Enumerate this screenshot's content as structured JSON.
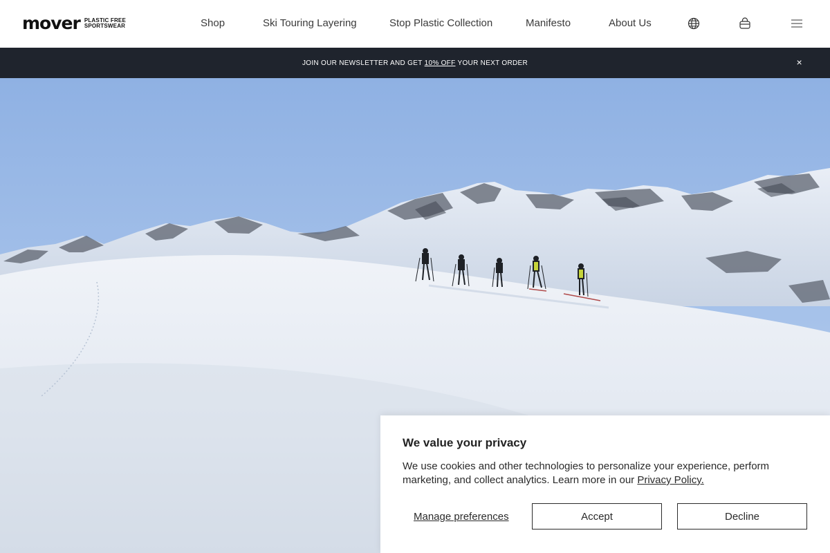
{
  "header": {
    "logo": {
      "word": "mover",
      "tag_line1": "PLASTIC FREE",
      "tag_line2": "SPORTSWEAR"
    },
    "nav": [
      {
        "label": "Shop"
      },
      {
        "label": "Ski Touring Layering"
      },
      {
        "label": "Stop Plastic Collection"
      },
      {
        "label": "Manifesto"
      },
      {
        "label": "About Us"
      }
    ],
    "icons": [
      "globe-icon",
      "cart-icon",
      "hamburger-menu-icon"
    ]
  },
  "announcement": {
    "text_before": "JOIN OUR NEWSLETTER AND GET",
    "highlight": "10% OFF",
    "text_after": "YOUR NEXT ORDER",
    "close": "×"
  },
  "cookie": {
    "title": "We value your privacy",
    "body": "We use cookies and other technologies to personalize your experience, perform marketing, and collect analytics. Learn more in our",
    "link": "Privacy Policy.",
    "manage": "Manage preferences",
    "accept": "Accept",
    "decline": "Decline"
  },
  "colors": {
    "announcement_bg": "#1f242d",
    "sky_top": "#7fa3d8",
    "snow": "#e6ebf2"
  }
}
